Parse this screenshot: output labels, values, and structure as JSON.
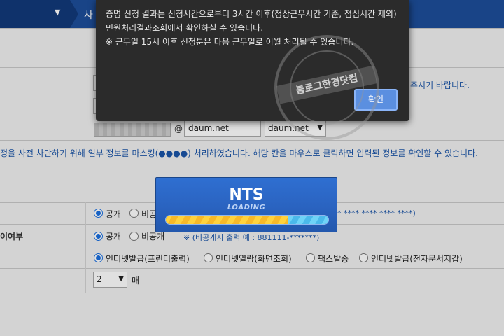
{
  "topbar": {
    "crumb": "사"
  },
  "form": {
    "email_local_masked": "",
    "at": "@",
    "email_domain": "daum.net",
    "email_domain_select": "daum.net",
    "notice_right": "주시기 바랍니다.",
    "privacy_notice": "정을 사전 차단하기 위해 일부 정보를 마스킹(●●●●) 처리하였습니다. 해당 칸을 마우스로 클릭하면 입력된 정보를 확인할 수 있습니다.",
    "row1": {
      "radio_public": "공개",
      "radio_private": "비공",
      "hint": "* **** **** **** ****)"
    },
    "row2": {
      "label": "이여부",
      "radio_public": "공개",
      "radio_private": "비공개",
      "hint": "※ (비공개시 출력 예 : 881111-*******)"
    },
    "row3": {
      "options": [
        "인터넷발급(프린터출력)",
        "인터넷열람(화면조회)",
        "팩스발송",
        "인터넷발급(전자문서지갑)"
      ],
      "selected_index": 0
    },
    "row4": {
      "copies": "2",
      "unit": "매"
    }
  },
  "alert": {
    "line1": "증명 신청 결과는 신청시간으로부터 3시간 이후(정상근무시간 기준, 점심시간 제외) 민원처리결과조회에서 확인하실 수 있습니다.",
    "line2": "※ 근무일 15시 이후 신청분은 다음 근무일로 이월 처리될 수 있습니다.",
    "ok_label": "확인"
  },
  "watermark": {
    "text": "블로그한경닷컴"
  },
  "loading": {
    "title": "NTS",
    "subtitle": "LOADING",
    "progress": 0.75
  }
}
